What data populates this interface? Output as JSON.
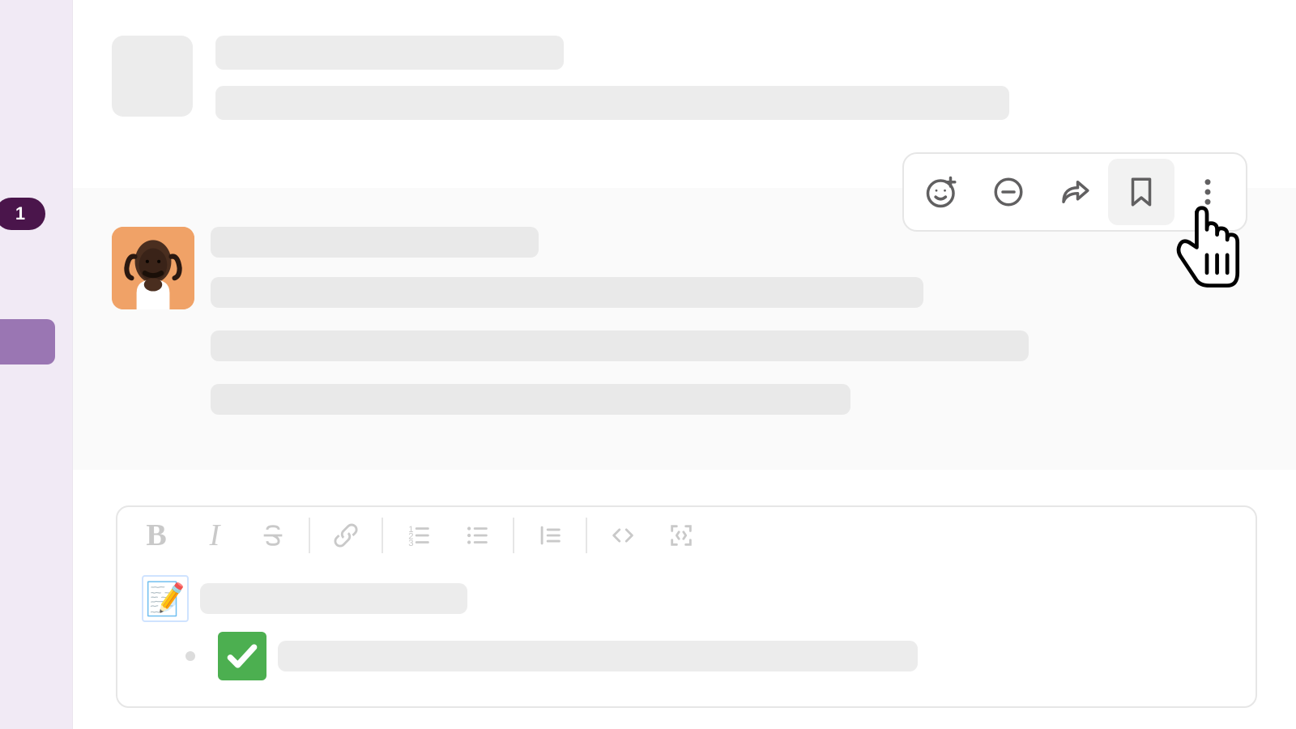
{
  "sidebar": {
    "badge_count": "1"
  },
  "message_actions": {
    "react": "add-reaction",
    "thread": "reply-in-thread",
    "share": "share-message",
    "save": "save-for-later",
    "more": "more-actions"
  },
  "composer": {
    "format": {
      "bold": "B",
      "italic": "I",
      "strike": "S"
    },
    "draft_memo_emoji": "📝",
    "draft_check_emoji": "✅"
  }
}
